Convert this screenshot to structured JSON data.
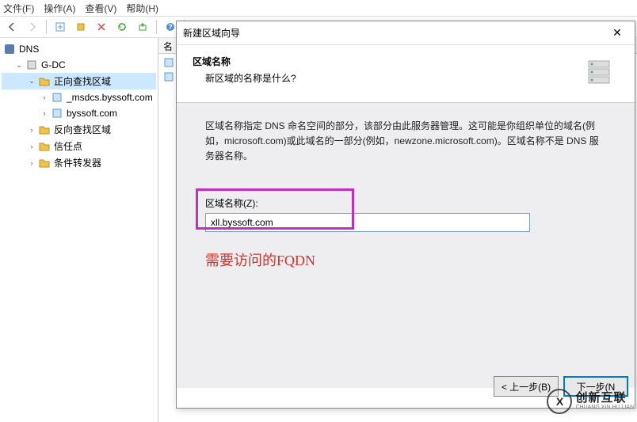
{
  "menubar": {
    "file": "文件(F)",
    "action": "操作(A)",
    "view": "查看(V)",
    "help": "帮助(H)"
  },
  "tree": {
    "root": "DNS",
    "server": "G-DC",
    "forward_zone": "正向查找区域",
    "zone1": "_msdcs.byssoft.com",
    "zone2": "byssoft.com",
    "reverse_zone": "反向查找区域",
    "trust_points": "信任点",
    "conditional_forwarders": "条件转发器"
  },
  "list": {
    "header_name": "名"
  },
  "wizard": {
    "title": "新建区域向导",
    "header_title": "区域名称",
    "header_subtitle": "新区域的名称是什么?",
    "description": "区域名称指定 DNS 命名空间的部分，该部分由此服务器管理。这可能是你组织单位的域名(例如，microsoft.com)或此域名的一部分(例如，newzone.microsoft.com)。区域名称不是 DNS 服务器名称。",
    "field_label": "区域名称(Z):",
    "field_value": "xll.byssoft.com",
    "annotation": "需要访问的FQDN",
    "back_btn": "< 上一步(B)",
    "next_btn": "下一步(N"
  },
  "watermark": {
    "logo": "X",
    "cn": "创新互联",
    "en": "CHUANG XIN HU LIAN"
  }
}
